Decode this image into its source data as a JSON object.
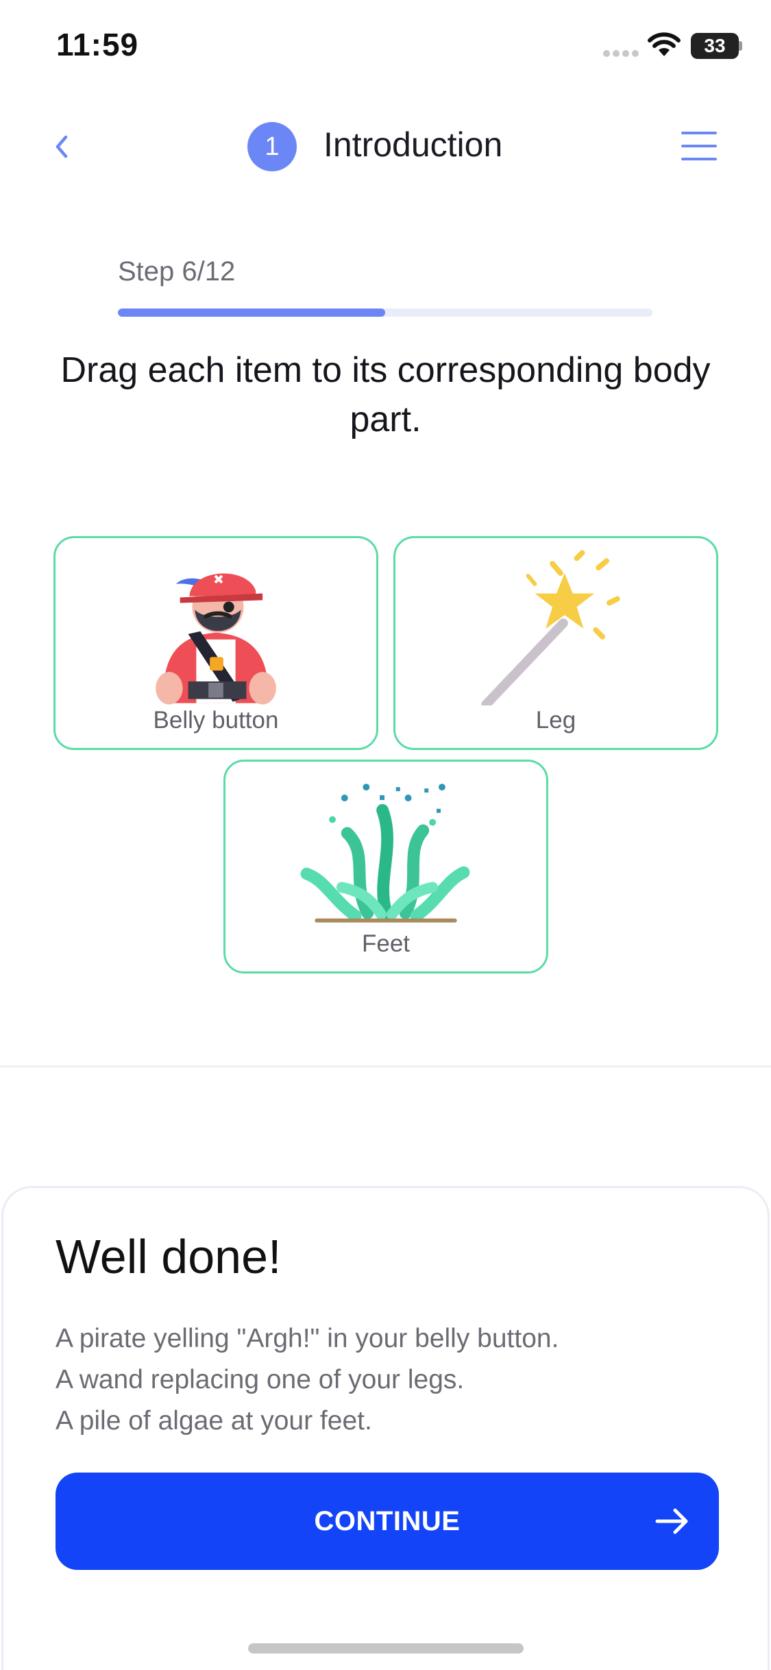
{
  "status_bar": {
    "time": "11:59",
    "battery": "33"
  },
  "header": {
    "back_icon": "chevron-left-icon",
    "step_number": "1",
    "title": "Introduction",
    "menu_icon": "hamburger-menu-icon"
  },
  "progress": {
    "label": "Step 6/12",
    "current": 6,
    "total": 12
  },
  "instruction": "Drag each item to its corresponding body part.",
  "items": [
    {
      "label": "Belly button",
      "icon": "pirate-icon"
    },
    {
      "label": "Leg",
      "icon": "magic-wand-icon"
    },
    {
      "label": "Feet",
      "icon": "algae-icon"
    }
  ],
  "result": {
    "title": "Well done!",
    "lines": [
      "A pirate yelling \"Argh!\" in your belly button.",
      "A wand replacing one of your legs.",
      "A pile of algae at your feet."
    ],
    "button_label": "CONTINUE",
    "button_icon": "arrow-right-icon"
  },
  "colors": {
    "accent": "#6b87f5",
    "button": "#1444f8",
    "card_border": "#59dca6"
  }
}
